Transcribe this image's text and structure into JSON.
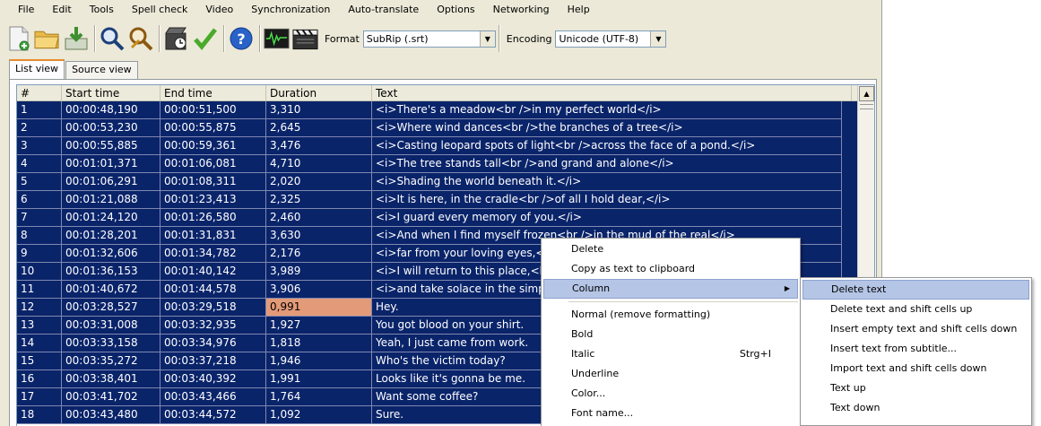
{
  "menu": [
    "File",
    "Edit",
    "Tools",
    "Spell check",
    "Video",
    "Synchronization",
    "Auto-translate",
    "Options",
    "Networking",
    "Help"
  ],
  "toolbar": {
    "buttons": [
      "new-icon",
      "open-folder-icon",
      "save-icon",
      "find-icon",
      "replace-icon",
      "visual-sync-icon",
      "spell-check-icon",
      "help-icon",
      "waveform-icon",
      "video-icon"
    ],
    "format_label": "Format",
    "format_value": "SubRip (.srt)",
    "encoding_label": "Encoding",
    "encoding_value": "Unicode (UTF-8)"
  },
  "tabs": [
    "List view",
    "Source view"
  ],
  "grid": {
    "columns": [
      "#",
      "Start time",
      "End time",
      "Duration",
      "Text"
    ],
    "rows": [
      [
        "1",
        "00:00:48,190",
        "00:00:51,500",
        "3,310",
        "<i>There's a meadow<br />in my perfect world</i>"
      ],
      [
        "2",
        "00:00:53,230",
        "00:00:55,875",
        "2,645",
        "<i>Where wind dances<br />the branches of a tree</i>"
      ],
      [
        "3",
        "00:00:55,885",
        "00:00:59,361",
        "3,476",
        "<i>Casting leopard spots of light<br />across the face of a pond.</i>"
      ],
      [
        "4",
        "00:01:01,371",
        "00:01:06,081",
        "4,710",
        "<i>The tree stands tall<br />and grand and alone</i>"
      ],
      [
        "5",
        "00:01:06,291",
        "00:01:08,311",
        "2,020",
        "<i>Shading the world beneath it.</i>"
      ],
      [
        "6",
        "00:01:21,088",
        "00:01:23,413",
        "2,325",
        "<i>It is here, in the cradle<br />of all I hold dear,</i>"
      ],
      [
        "7",
        "00:01:24,120",
        "00:01:26,580",
        "2,460",
        "<i>I guard every memory of you.</i>"
      ],
      [
        "8",
        "00:01:28,201",
        "00:01:31,831",
        "3,630",
        "<i>And when I find myself frozen<br />in the mud of the real</i>"
      ],
      [
        "9",
        "00:01:32,606",
        "00:01:34,782",
        "2,176",
        "<i>far from your loving eyes,</i>"
      ],
      [
        "10",
        "00:01:36,153",
        "00:01:40,142",
        "3,989",
        "<i>I will return to this place,<br />"
      ],
      [
        "11",
        "00:01:40,672",
        "00:01:44,578",
        "3,906",
        "<i>and take solace in the simpl"
      ],
      [
        "12",
        "00:03:28,527",
        "00:03:29,518",
        "0,991",
        "Hey."
      ],
      [
        "13",
        "00:03:31,008",
        "00:03:32,935",
        "1,927",
        "You got blood on your shirt."
      ],
      [
        "14",
        "00:03:33,158",
        "00:03:34,976",
        "1,818",
        "Yeah, I just came from work."
      ],
      [
        "15",
        "00:03:35,272",
        "00:03:37,218",
        "1,946",
        "Who's the victim today?"
      ],
      [
        "16",
        "00:03:38,401",
        "00:03:40,392",
        "1,991",
        "Looks like it's gonna be me."
      ],
      [
        "17",
        "00:03:41,702",
        "00:03:43,466",
        "1,764",
        "Want some coffee?"
      ],
      [
        "18",
        "00:03:43,480",
        "00:03:44,572",
        "1,092",
        "Sure."
      ]
    ],
    "warn_row_index": 11,
    "selection_color": "#0a246a",
    "warn_color": "#e39a78"
  },
  "context_menu": {
    "items": [
      {
        "label": "Delete"
      },
      {
        "label": "Copy as text to clipboard"
      },
      {
        "label": "Column",
        "submenu": true,
        "highlighted": true
      },
      {
        "separator": true
      },
      {
        "label": "Normal (remove formatting)"
      },
      {
        "label": "Bold"
      },
      {
        "label": "Italic",
        "shortcut": "Strg+I"
      },
      {
        "label": "Underline"
      },
      {
        "label": "Color..."
      },
      {
        "label": "Font name..."
      }
    ]
  },
  "column_submenu": {
    "items": [
      {
        "label": "Delete text",
        "highlighted": true
      },
      {
        "label": "Delete text and shift cells up"
      },
      {
        "label": "Insert empty text and shift cells down"
      },
      {
        "label": "Insert text from subtitle..."
      },
      {
        "label": "Import text and shift cells down"
      },
      {
        "label": "Text up"
      },
      {
        "label": "Text down"
      }
    ]
  }
}
